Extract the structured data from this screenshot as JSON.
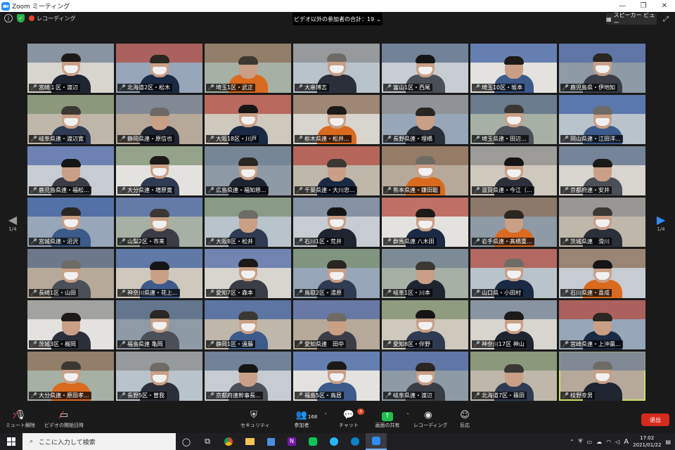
{
  "window": {
    "title": "Zoom ミーティング",
    "minimize_icon": "minimize-icon",
    "maximize_icon": "maximize-icon",
    "close_icon": "close-icon"
  },
  "topbar": {
    "recording_label": "レコーディング",
    "participant_count_label": "ビデオ以外の参加者の合計：19",
    "speaker_view_label": "スピーカー ビュー"
  },
  "pagination": {
    "left": "1/4",
    "right": "1/4"
  },
  "participants": [
    {
      "name": "宮崎１区・渡辺"
    },
    {
      "name": "北海道2区・松木"
    },
    {
      "name": "埼玉1区・武正"
    },
    {
      "name": "大串博志"
    },
    {
      "name": "富山1区・西尾"
    },
    {
      "name": "埼玉10区・坂本"
    },
    {
      "name": "鹿児島県・伊地知"
    },
    {
      "name": "岐阜県連・渡辺寛"
    },
    {
      "name": "静岡県連・原信也"
    },
    {
      "name": "大阪18区・川戸"
    },
    {
      "name": "栃木県連・松井..."
    },
    {
      "name": "長野県連・埋橋"
    },
    {
      "name": "埼玉県連・田辺..."
    },
    {
      "name": "岡山県連・江田洋..."
    },
    {
      "name": "鹿児島県連・福松..."
    },
    {
      "name": "大分県連・増原寛"
    },
    {
      "name": "広島県連・福知慈..."
    },
    {
      "name": "千葉県連・大川忠..."
    },
    {
      "name": "熊本県連・鎌田聡"
    },
    {
      "name": "滋賀県連・今江（..."
    },
    {
      "name": "京都府連・安井"
    },
    {
      "name": "宮城県連・沼沢"
    },
    {
      "name": "山梨2区・市来"
    },
    {
      "name": "大阪8区・松井"
    },
    {
      "name": "石川1区・荒井"
    },
    {
      "name": "群馬県連 八木田"
    },
    {
      "name": "岩手県連・髙橋重..."
    },
    {
      "name": "茨城県連　滑川"
    },
    {
      "name": "長崎1区・山田"
    },
    {
      "name": "神奈川県連・花上..."
    },
    {
      "name": "愛知7区・森本"
    },
    {
      "name": "鳥取2区・湯原"
    },
    {
      "name": "岐阜1区・川本"
    },
    {
      "name": "山口県・小田村"
    },
    {
      "name": "石川県連・喜成"
    },
    {
      "name": "茨城3区・梶岡"
    },
    {
      "name": "福島県連 亀岡"
    },
    {
      "name": "静岡1区・遠藤"
    },
    {
      "name": "愛知県連　田中"
    },
    {
      "name": "愛知8区・伴野"
    },
    {
      "name": "神奈川17区 神山"
    },
    {
      "name": "宮崎県連・上沖薫..."
    },
    {
      "name": "大分県連・原田孝..."
    },
    {
      "name": "長野5区・曽我"
    },
    {
      "name": "京都府連幹事長..."
    },
    {
      "name": "福島5区・鳥居"
    },
    {
      "name": "岐阜県連・渡辺"
    },
    {
      "name": "北海道7区・篠田"
    },
    {
      "name": "枝野幸男"
    }
  ],
  "toolbar": {
    "mute_label": "ミュート解除",
    "video_label": "ビデオの開始日時",
    "security_label": "セキュリティ",
    "participants_label": "参加者",
    "participants_count": "168",
    "chat_label": "チャット",
    "chat_badge": "4",
    "share_label": "画面の共有",
    "record_label": "レコーディング",
    "reactions_label": "反応",
    "leave_label": "退出"
  },
  "taskbar": {
    "search_placeholder": "ここに入力して検索",
    "ime_label": "A",
    "time": "17:02",
    "date": "2021/01/22"
  },
  "colors": {
    "active_speaker_outline": "#c8e06a",
    "leave_button": "#d52b1e",
    "share_button": "#1fbf4b",
    "nav_arrow_right": "#2d8cff",
    "muted_mic": "#ff3b3b"
  }
}
